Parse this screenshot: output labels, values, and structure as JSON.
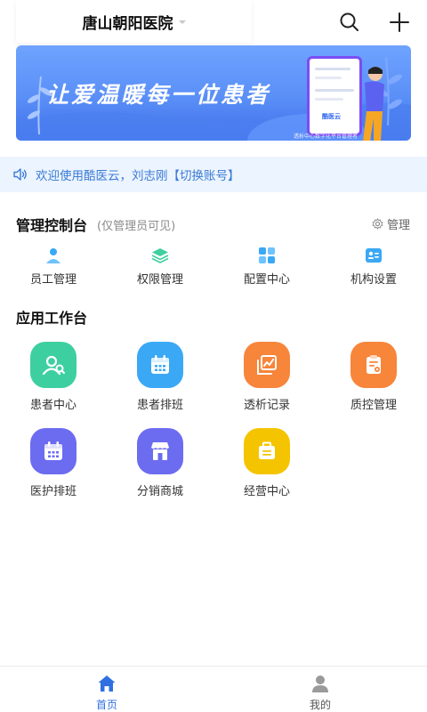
{
  "header": {
    "hospital_name": "唐山朝阳医院",
    "search_icon": "search-icon",
    "add_icon": "plus-icon"
  },
  "banner": {
    "slogan": "让爱温暖每一位患者",
    "phone_logo": "酷医云",
    "caption": "透析中心数字化平台管理者"
  },
  "notice": {
    "icon": "speaker-icon",
    "text": "欢迎使用酷医云，刘志刚【切换账号】"
  },
  "admin": {
    "title": "管理控制台",
    "note": "(仅管理员可见)",
    "manage_label": "管理",
    "items": [
      {
        "label": "员工管理",
        "icon": "user-icon"
      },
      {
        "label": "权限管理",
        "icon": "layers-icon"
      },
      {
        "label": "配置中心",
        "icon": "grid-icon"
      },
      {
        "label": "机构设置",
        "icon": "id-card-icon"
      }
    ]
  },
  "apps": {
    "title": "应用工作台",
    "items": [
      {
        "label": "患者中心",
        "icon": "patients-icon",
        "color": "#3ecfa0"
      },
      {
        "label": "患者排班",
        "icon": "calendar-icon",
        "color": "#3aa8f5"
      },
      {
        "label": "透析记录",
        "icon": "record-icon",
        "color": "#f7853a"
      },
      {
        "label": "质控管理",
        "icon": "clipboard-icon",
        "color": "#f7853a"
      },
      {
        "label": "医护排班",
        "icon": "calendar-icon",
        "color": "#6c6cf0"
      },
      {
        "label": "分销商城",
        "icon": "store-icon",
        "color": "#6c6cf0"
      },
      {
        "label": "经营中心",
        "icon": "briefcase-icon",
        "color": "#f5c400"
      }
    ]
  },
  "tabbar": {
    "tabs": [
      {
        "label": "首页",
        "icon": "home-icon",
        "active": true
      },
      {
        "label": "我的",
        "icon": "profile-icon",
        "active": false
      }
    ]
  },
  "colors": {
    "accent": "#3a7bd5",
    "tab_active": "#2f6fe0",
    "tab_inactive": "#888888",
    "notice_bg": "#ecf4ff"
  }
}
